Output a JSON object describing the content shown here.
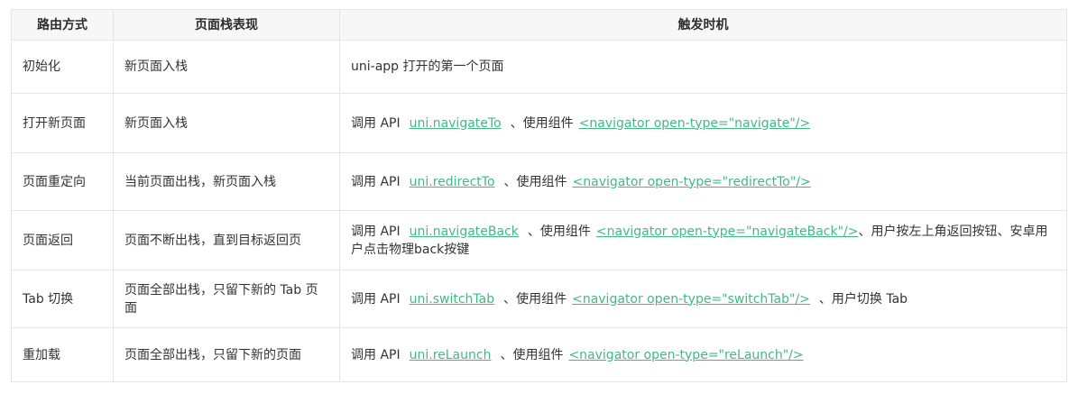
{
  "table": {
    "headers": [
      "路由方式",
      "页面栈表现",
      "触发时机"
    ],
    "rows": [
      {
        "method": "初始化",
        "stack": "新页面入栈",
        "trigger": {
          "text": "uni-app 打开的第一个页面"
        }
      },
      {
        "method": "打开新页面",
        "stack": "新页面入栈",
        "trigger": {
          "prefix": "调用 API",
          "api_link": "uni.navigateTo",
          "mid": "、使用组件",
          "component_link": "<navigator open-type=\"navigate\"/>",
          "suffix": ""
        }
      },
      {
        "method": "页面重定向",
        "stack": "当前页面出栈，新页面入栈",
        "trigger": {
          "prefix": "调用 API",
          "api_link": "uni.redirectTo",
          "mid": "、使用组件",
          "component_link": "<navigator open-type=\"redirectTo\"/>",
          "suffix": ""
        }
      },
      {
        "method": "页面返回",
        "stack": "页面不断出栈，直到目标返回页",
        "trigger": {
          "prefix": "调用 API",
          "api_link": "uni.navigateBack",
          "mid": "、使用组件",
          "component_link": "<navigator open-type=\"navigateBack\"/>",
          "suffix": "、用户按左上角返回按钮、安卓用户点击物理back按键"
        }
      },
      {
        "method": "Tab 切换",
        "stack": "页面全部出栈，只留下新的 Tab 页面",
        "trigger": {
          "prefix": "调用 API",
          "api_link": "uni.switchTab",
          "mid": "、使用组件",
          "component_link": "<navigator open-type=\"switchTab\"/>",
          "suffix": "、用户切换 Tab"
        }
      },
      {
        "method": "重加载",
        "stack": "页面全部出栈，只留下新的页面",
        "trigger": {
          "prefix": "调用 API",
          "api_link": "uni.reLaunch",
          "mid": "、使用组件",
          "component_link": "<navigator open-type=\"reLaunch\"/>",
          "suffix": ""
        }
      }
    ]
  },
  "colors": {
    "link": "#42b983",
    "border": "#e5e5e5",
    "header_bg": "#f7f7f7",
    "text": "#333333"
  }
}
